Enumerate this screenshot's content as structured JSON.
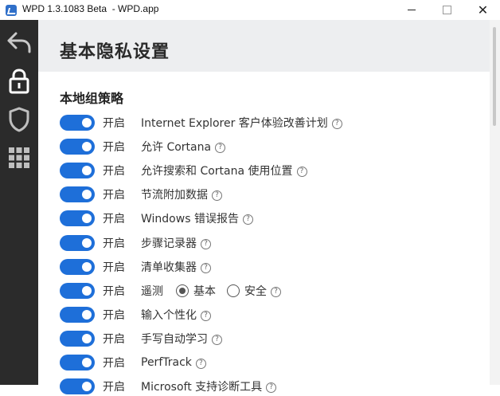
{
  "window": {
    "title": "WPD 1.3.1083 Beta  - WPD.app",
    "minimize": "—",
    "maximize": "☐",
    "close": "✕"
  },
  "sidebar": {
    "items": [
      {
        "icon": "back-arrow-icon"
      },
      {
        "icon": "lock-icon",
        "active": true
      },
      {
        "icon": "shield-icon"
      },
      {
        "icon": "grid-icon"
      }
    ]
  },
  "page": {
    "title": "基本隐私设置",
    "section_title": "本地组策略"
  },
  "colors": {
    "toggle_on": "#1e6fd9",
    "sidebar_bg": "#2b2b2b",
    "header_bg": "#edeef0"
  },
  "help_glyph": "?",
  "policies": [
    {
      "state": "开启",
      "label": "Internet Explorer 客户体验改善计划",
      "on": true
    },
    {
      "state": "开启",
      "label": "允许 Cortana",
      "on": true
    },
    {
      "state": "开启",
      "label": "允许搜索和 Cortana 使用位置",
      "on": true
    },
    {
      "state": "开启",
      "label": "节流附加数据",
      "on": true
    },
    {
      "state": "开启",
      "label": "Windows 错误报告",
      "on": true
    },
    {
      "state": "开启",
      "label": "步骤记录器",
      "on": true
    },
    {
      "state": "开启",
      "label": "清单收集器",
      "on": true
    },
    {
      "state": "开启",
      "label": "遥测",
      "on": true,
      "radio": {
        "options": [
          "基本",
          "安全"
        ],
        "selected": "基本"
      }
    },
    {
      "state": "开启",
      "label": "输入个性化",
      "on": true
    },
    {
      "state": "开启",
      "label": "手写自动学习",
      "on": true
    },
    {
      "state": "开启",
      "label": "PerfTrack",
      "on": true
    },
    {
      "state": "开启",
      "label": "Microsoft 支持诊断工具",
      "on": true
    }
  ]
}
